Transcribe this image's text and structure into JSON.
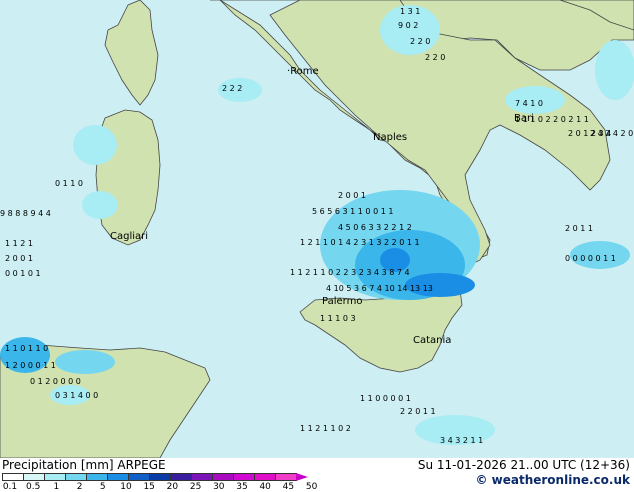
{
  "footer": {
    "title": "Precipitation [mm]  ARPEGE",
    "valid": "Su 11-01-2026 21..00 UTC (12+36)",
    "credit": "© weatheronline.co.uk"
  },
  "legend": {
    "ticks": [
      "0.1",
      "0.5",
      "1",
      "2",
      "5",
      "10",
      "15",
      "20",
      "25",
      "30",
      "35",
      "40",
      "45",
      "50"
    ],
    "colors": [
      "#ffffff",
      "#d7f7f7",
      "#a8ecf4",
      "#74d6ef",
      "#3bb6ea",
      "#1a8ee4",
      "#1060c8",
      "#0a3ca8",
      "#3a1ea0",
      "#7a14b8",
      "#a80cc0",
      "#d00ad0",
      "#e010c8",
      "#f03cc8",
      "#c800c8"
    ]
  },
  "cities": [
    {
      "name": "Rome",
      "icon": "city-dot-icon"
    },
    {
      "name": "Naples",
      "icon": "city-dot-icon"
    },
    {
      "name": "Bari",
      "icon": "city-dot-icon"
    },
    {
      "name": "Cagliari",
      "icon": "city-dot-icon"
    },
    {
      "name": "Palermo",
      "icon": "city-dot-icon"
    },
    {
      "name": "Catania",
      "icon": "city-dot-icon"
    }
  ],
  "values": [
    "0",
    "1",
    "2",
    "3",
    "4",
    "5",
    "6",
    "7",
    "9",
    "10",
    "11",
    "12",
    "13",
    "14",
    "15",
    "1 3 1",
    "9 0 2",
    "2 2 0",
    "2 2 0",
    "2 2 2",
    "0",
    "0",
    "2",
    "7 4 1 0",
    "2 0 1 2 3 4",
    "1 1 1 0 2 2 0 2 1 1",
    "0 1 1 0",
    "5 6 5 6 3 1 1 0 0 1 1",
    "3 4 1 1",
    "2 0 0 1",
    "4 5 0 6 3 3 2 2 1 2",
    "1 2 1 1 0 1 4 2 3 1 3 2 2 0 1 1",
    "1 1 2 1 1 0 2 2 3 2 3 4 3 8 7 4",
    "4 10 5 3 6 7 4 10 14 13 13",
    "1 1 1 0 3",
    "4 2 0 0",
    "9 8 8 8 9 4 4",
    "1 1 2 1",
    "2 0 0 1",
    "0 0 1 0 1",
    "0 1 1 0",
    "1 1 0 1 1 0",
    "1 2 0 0 0 1 1",
    "0 0 0 0 0 1 1",
    "2 0 1 1",
    "2 4 2 4 2 0",
    "0 1 2 0",
    "1 1 0 0 0 0 1",
    "1 1 2 1 1 0 2",
    "3 4 3 2 1 1",
    "2 2 0 1 1",
    "0 3 1 4 0 0",
    "0 1 2 0 0 0 0",
    "1 0 1 1 1 0 0",
    "0 0 1 0 1 1 0 0 1 0 0",
    "0 0 1 0 0 0 0 1 1 0 0 0 0 1",
    "6 1 0 1 0 1 0 0 0 1 0 1 1 0 0 0 0 0",
    "0 1 1 1 0 0 1",
    "0 2 1 2 1",
    "1 1 1 0 0 1"
  ]
}
